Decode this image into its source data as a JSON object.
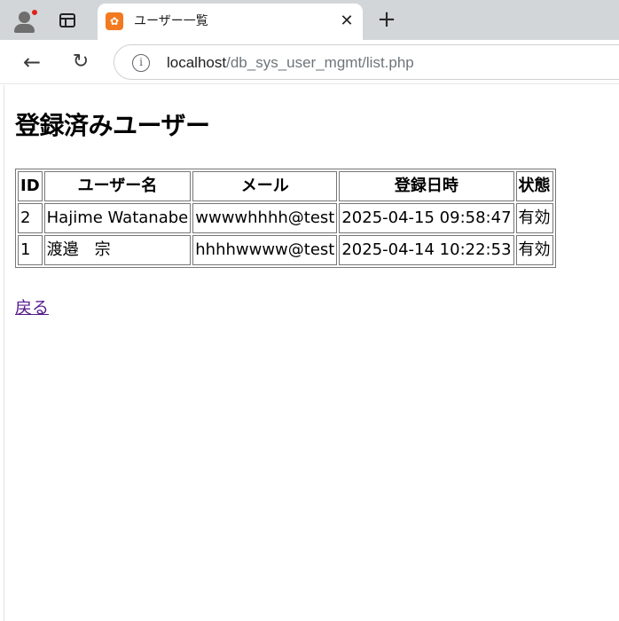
{
  "browser": {
    "tab_title": "ユーザー一覧",
    "tab_close": "✕",
    "new_tab": "+",
    "url_host": "localhost",
    "url_path": "/db_sys_user_mgmt/list.php",
    "favicon_glyph": "✿",
    "back_glyph": "←",
    "reload_glyph": "↻",
    "info_glyph": "i",
    "icons": {
      "profile": "profile-icon",
      "tab_actions": "tab-actions-icon",
      "favicon": "xampp-favicon-icon",
      "close": "close-icon",
      "new_tab": "plus-icon",
      "back": "back-arrow-icon",
      "reload": "reload-icon",
      "site_info": "info-icon"
    },
    "notification_color": "#e0201b"
  },
  "page": {
    "title": "登録済みユーザー",
    "table": {
      "headers": [
        "ID",
        "ユーザー名",
        "メール",
        "登録日時",
        "状態"
      ],
      "rows": [
        [
          "2",
          "Hajime Watanabe",
          "wwwwhhhh@test",
          "2025-04-15 09:58:47",
          "有効"
        ],
        [
          "1",
          "渡邉　宗",
          "hhhhwwww@test",
          "2025-04-14 10:22:53",
          "有効"
        ]
      ]
    },
    "back_link": "戻る",
    "link_color": "#551a8b"
  }
}
